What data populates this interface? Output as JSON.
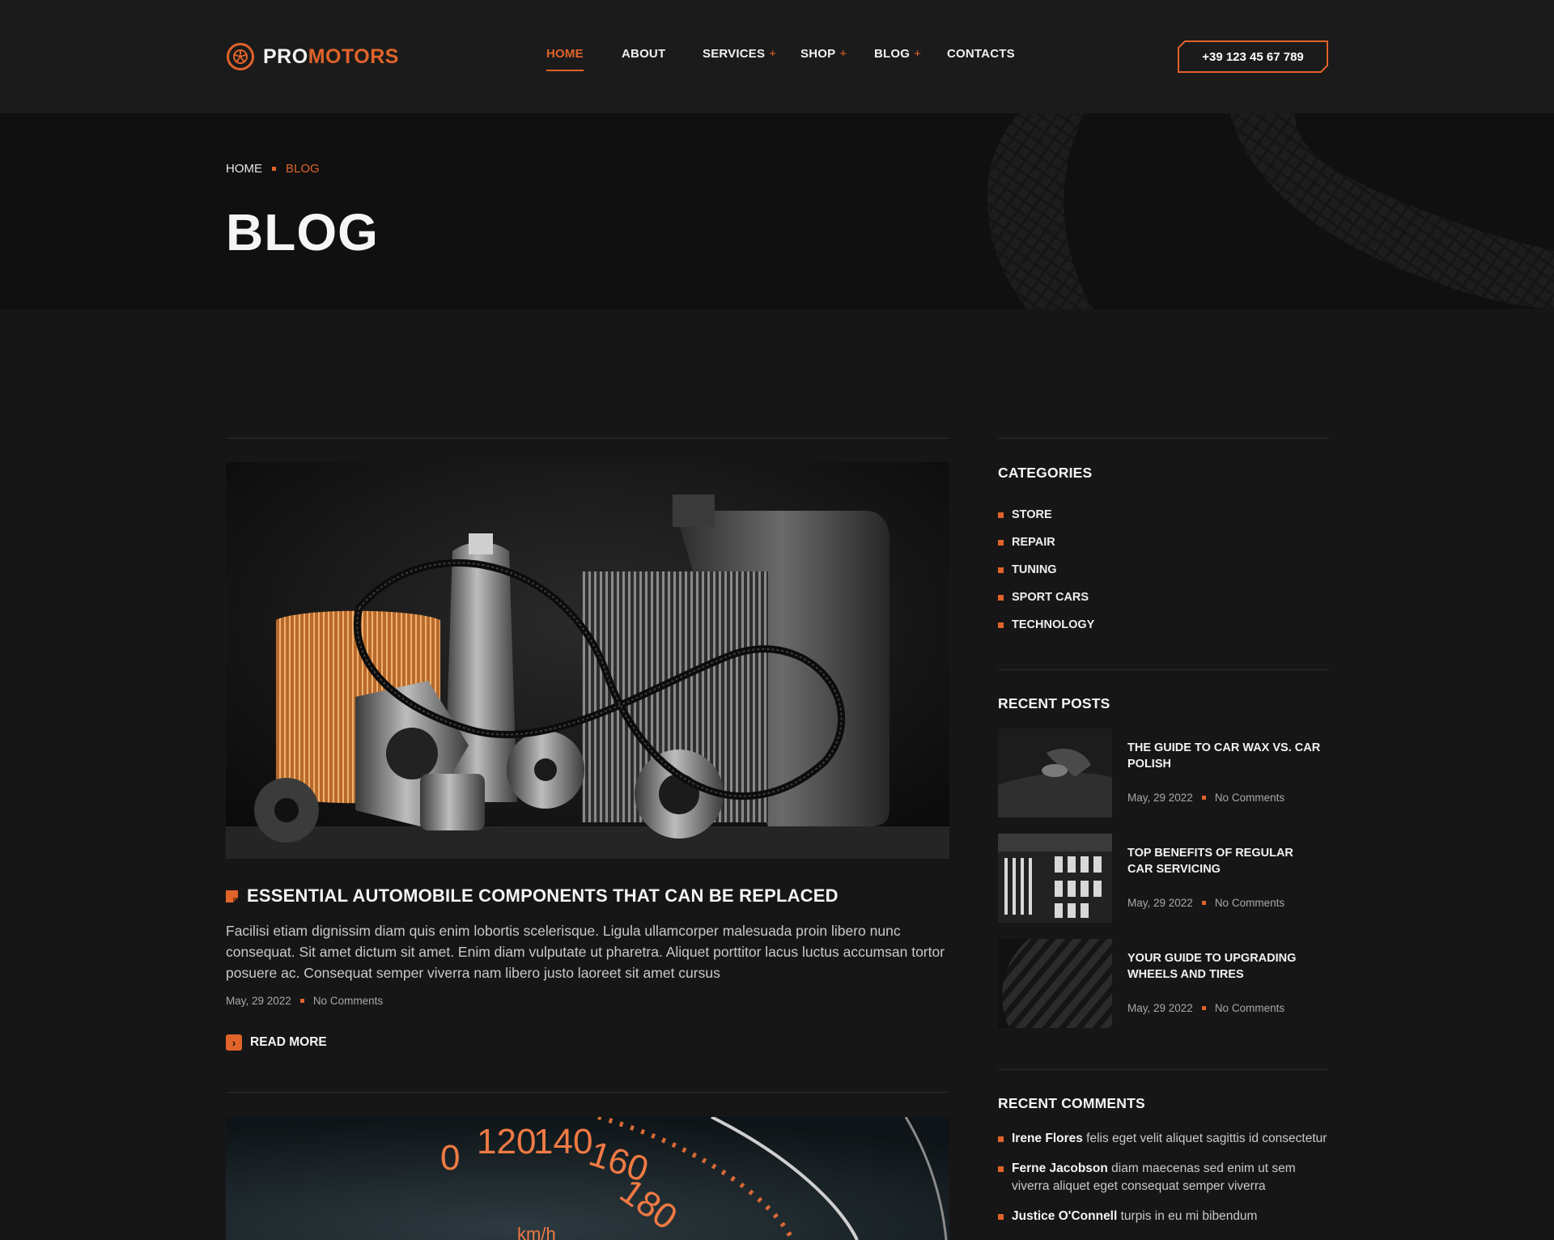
{
  "brand": {
    "name_part1": "PRO",
    "name_part2": "MOTORS",
    "accent": "#e0632a"
  },
  "nav": {
    "home": "HOME",
    "about": "ABOUT",
    "services": "SERVICES",
    "shop": "SHOP",
    "blog": "BLOG",
    "contacts": "CONTACTS",
    "plus": "+"
  },
  "phone": "+39 123 45 67 789",
  "breadcrumb": {
    "home": "HOME",
    "current": "BLOG"
  },
  "page_title": "BLOG",
  "posts": [
    {
      "title": "ESSENTIAL AUTOMOBILE COMPONENTS THAT CAN BE REPLACED",
      "excerpt": "Facilisi etiam dignissim diam quis enim lobortis scelerisque. Ligula ullamcorper malesuada proin libero nunc consequat. Sit amet dictum sit amet. Enim diam vulputate ut pharetra. Aliquet porttitor lacus luctus accumsan tortor posuere ac. Consequat semper viverra nam libero justo laoreet sit amet cursus",
      "date": "May, 29 2022",
      "comments": "No Comments",
      "read_more": "READ MORE"
    }
  ],
  "speedometer": {
    "labels": [
      "0",
      "120",
      "140",
      "160",
      "180",
      "km/h"
    ]
  },
  "sidebar": {
    "categories_heading": "CATEGORIES",
    "categories": [
      "STORE",
      "REPAIR",
      "TUNING",
      "SPORT CARS",
      "TECHNOLOGY"
    ],
    "recent_posts_heading": "RECENT POSTS",
    "recent_posts": [
      {
        "title": "THE GUIDE TO CAR WAX VS. CAR POLISH",
        "date": "May, 29 2022",
        "comments": "No Comments"
      },
      {
        "title": "TOP BENEFITS OF REGULAR CAR SERVICING",
        "date": "May, 29 2022",
        "comments": "No Comments"
      },
      {
        "title": "YOUR GUIDE TO UPGRADING WHEELS AND TIRES",
        "date": "May, 29 2022",
        "comments": "No Comments"
      }
    ],
    "recent_comments_heading": "RECENT COMMENTS",
    "recent_comments": [
      {
        "author": "Irene Flores",
        "text": " felis eget velit aliquet sagittis id consectetur"
      },
      {
        "author": "Ferne Jacobson",
        "text": " diam maecenas sed enim ut sem viverra aliquet eget consequat semper viverra"
      },
      {
        "author": "Justice O'Connell",
        "text": " turpis in eu mi bibendum"
      }
    ]
  }
}
